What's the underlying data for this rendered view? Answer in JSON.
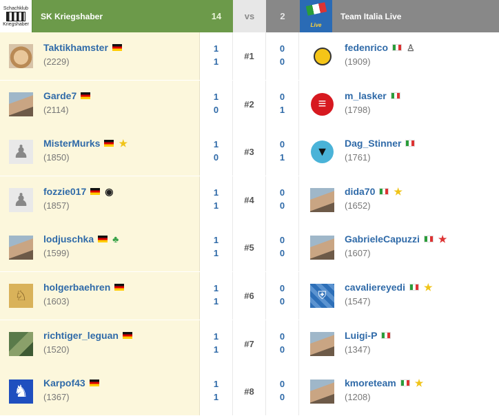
{
  "header": {
    "left_team": "SK Kriegshaber",
    "left_score": "14",
    "vs": "vs",
    "right_score": "2",
    "right_team": "Team Italia Live",
    "left_logo_text_top": "Schachklub",
    "left_logo_text_bottom": "Kriegshaber",
    "right_logo_text": "Live"
  },
  "rows": [
    {
      "board": "#1",
      "left": {
        "name": "Taktikhamster",
        "rating": "(2229)",
        "flag": "de",
        "badge": "",
        "avatar": "hamster-avatar",
        "s1": "1",
        "s2": "1"
      },
      "right": {
        "name": "fedenrico",
        "rating": "(1909)",
        "flag": "it",
        "badge": "pawn-outline",
        "avatar": "smiley-avatar",
        "s1": "0",
        "s2": "0"
      }
    },
    {
      "board": "#2",
      "left": {
        "name": "Garde7",
        "rating": "(2114)",
        "flag": "de",
        "badge": "",
        "avatar": "photo-avatar",
        "s1": "1",
        "s2": "0"
      },
      "right": {
        "name": "m_lasker",
        "rating": "(1798)",
        "flag": "it",
        "badge": "",
        "avatar": "red-logo-avatar",
        "s1": "0",
        "s2": "1"
      }
    },
    {
      "board": "#3",
      "left": {
        "name": "MisterMurks",
        "rating": "(1850)",
        "flag": "de",
        "badge": "star",
        "avatar": "pawn-avatar",
        "s1": "1",
        "s2": "0"
      },
      "right": {
        "name": "Dag_Stinner",
        "rating": "(1761)",
        "flag": "it",
        "badge": "",
        "avatar": "wolf-avatar",
        "s1": "0",
        "s2": "1"
      }
    },
    {
      "board": "#4",
      "left": {
        "name": "fozzie017",
        "rating": "(1857)",
        "flag": "de",
        "badge": "panda",
        "avatar": "pawn-avatar",
        "s1": "1",
        "s2": "1"
      },
      "right": {
        "name": "dida70",
        "rating": "(1652)",
        "flag": "it",
        "badge": "star",
        "avatar": "photo-avatar",
        "s1": "0",
        "s2": "0"
      }
    },
    {
      "board": "#5",
      "left": {
        "name": "lodjuschka",
        "rating": "(1599)",
        "flag": "de",
        "badge": "clover",
        "avatar": "photo-avatar",
        "s1": "1",
        "s2": "1"
      },
      "right": {
        "name": "GabrieleCapuzzi",
        "rating": "(1607)",
        "flag": "it",
        "badge": "red-star",
        "avatar": "photo-avatar",
        "s1": "0",
        "s2": "0"
      }
    },
    {
      "board": "#6",
      "left": {
        "name": "holgerbaehren",
        "rating": "(1603)",
        "flag": "de",
        "badge": "",
        "avatar": "giraffe-avatar",
        "s1": "1",
        "s2": "1"
      },
      "right": {
        "name": "cavaliereyedi",
        "rating": "(1547)",
        "flag": "it",
        "badge": "star",
        "avatar": "shield-avatar",
        "s1": "0",
        "s2": "0"
      }
    },
    {
      "board": "#7",
      "left": {
        "name": "richtiger_leguan",
        "rating": "(1520)",
        "flag": "de",
        "badge": "",
        "avatar": "iguana-avatar",
        "s1": "1",
        "s2": "1"
      },
      "right": {
        "name": "Luigi-P",
        "rating": "(1347)",
        "flag": "it",
        "badge": "",
        "avatar": "photo-avatar",
        "s1": "0",
        "s2": "0"
      }
    },
    {
      "board": "#8",
      "left": {
        "name": "Karpof43",
        "rating": "(1367)",
        "flag": "de",
        "badge": "",
        "avatar": "blue-knight-avatar",
        "s1": "1",
        "s2": "1"
      },
      "right": {
        "name": "kmoreteam",
        "rating": "(1208)",
        "flag": "it",
        "badge": "star",
        "avatar": "photo-avatar",
        "s1": "0",
        "s2": "0"
      }
    }
  ],
  "colors": {
    "left_header": "#6c9a4a",
    "right_header": "#888888",
    "left_rows": "#fcf7dc",
    "link": "#2f6aa8"
  }
}
